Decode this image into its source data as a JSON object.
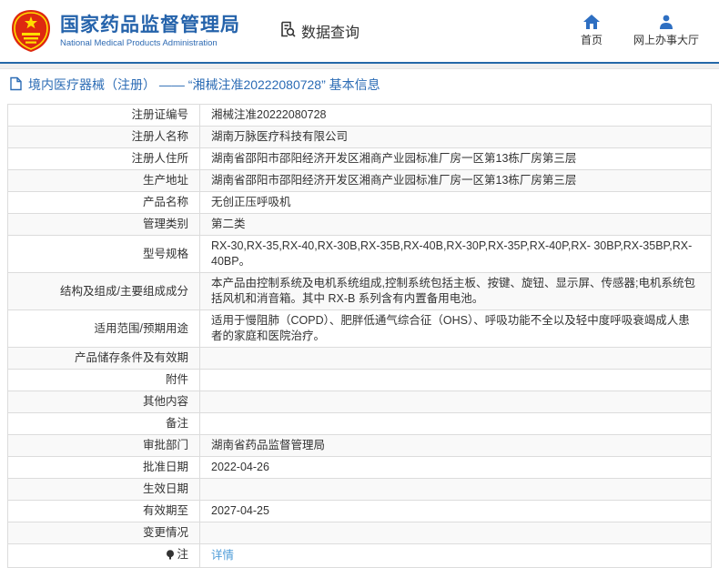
{
  "header": {
    "title": "国家药品监督管理局",
    "subtitle": "National Medical Products Administration",
    "section_label": "数据查询",
    "nav": [
      {
        "label": "首页",
        "icon": "home-icon"
      },
      {
        "label": "网上办事大厅",
        "icon": "user-icon"
      }
    ]
  },
  "breadcrumb": {
    "text": "境内医疗器械（注册） —— “湘械注准20222080728” 基本信息"
  },
  "table": {
    "rows": [
      {
        "label": "注册证编号",
        "value": "湘械注准20222080728"
      },
      {
        "label": "注册人名称",
        "value": "湖南万脉医疗科技有限公司"
      },
      {
        "label": "注册人住所",
        "value": "湖南省邵阳市邵阳经济开发区湘商产业园标准厂房一区第13栋厂房第三层"
      },
      {
        "label": "生产地址",
        "value": "湖南省邵阳市邵阳经济开发区湘商产业园标准厂房一区第13栋厂房第三层"
      },
      {
        "label": "产品名称",
        "value": "无创正压呼吸机"
      },
      {
        "label": "管理类别",
        "value": "第二类"
      },
      {
        "label": "型号规格",
        "value": "RX-30,RX-35,RX-40,RX-30B,RX-35B,RX-40B,RX-30P,RX-35P,RX-40P,RX- 30BP,RX-35BP,RX-40BP。"
      },
      {
        "label": "结构及组成/主要组成成分",
        "value": "本产品由控制系统及电机系统组成,控制系统包括主板、按键、旋钮、显示屏、传感器;电机系统包括风机和消音箱。其中 RX-B 系列含有内置备用电池。"
      },
      {
        "label": "适用范围/预期用途",
        "value": "适用于慢阻肺（COPD）、肥胖低通气综合征（OHS）、呼吸功能不全以及轻中度呼吸衰竭成人患者的家庭和医院治疗。"
      },
      {
        "label": "产品储存条件及有效期",
        "value": ""
      },
      {
        "label": "附件",
        "value": ""
      },
      {
        "label": "其他内容",
        "value": ""
      },
      {
        "label": "备注",
        "value": ""
      },
      {
        "label": "审批部门",
        "value": "湖南省药品监督管理局"
      },
      {
        "label": "批准日期",
        "value": "2022-04-26"
      },
      {
        "label": "生效日期",
        "value": ""
      },
      {
        "label": "有效期至",
        "value": "2027-04-25"
      },
      {
        "label": "变更情况",
        "value": ""
      },
      {
        "label": "注",
        "value": "详情"
      }
    ]
  },
  "colors": {
    "brand_blue": "#2563ab",
    "breadcrumb_blue": "#2c6cb5",
    "link_blue": "#4e9cd8",
    "emblem_red": "#de2910",
    "emblem_yellow": "#ffde00",
    "row_alt_bg": "#f9f9f9",
    "border": "#dcdcdc"
  }
}
